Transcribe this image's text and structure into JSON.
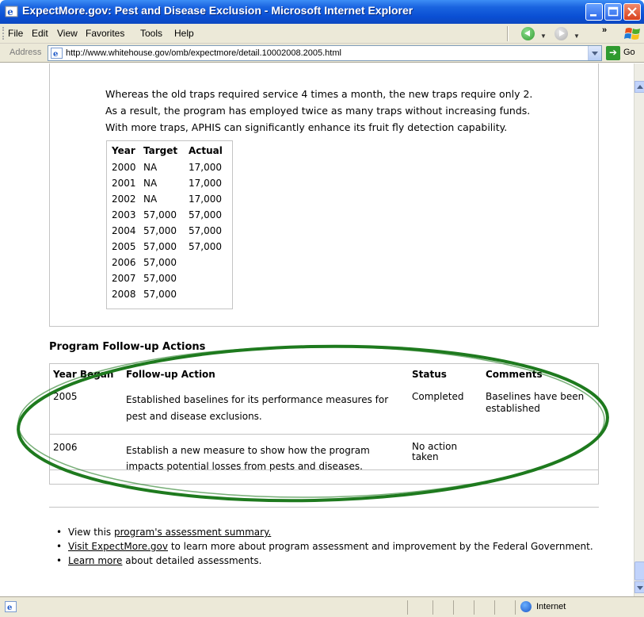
{
  "window": {
    "title": "ExpectMore.gov: Pest and Disease Exclusion - Microsoft Internet Explorer"
  },
  "menu": [
    "File",
    "Edit",
    "View",
    "Favorites",
    "Tools",
    "Help"
  ],
  "address": {
    "label": "Address",
    "url": "http://www.whitehouse.gov/omb/expectmore/detail.10002008.2005.html",
    "go_label": "Go"
  },
  "content": {
    "paragraph_lines": [
      "Whereas the old traps required service 4 times a month, the new traps require only 2.",
      "As a result, the program has employed twice as many traps without increasing funds.",
      "With more traps, APHIS can significantly enhance its fruit fly detection capability."
    ],
    "measure_table": {
      "headers": [
        "Year",
        "Target",
        "Actual"
      ],
      "rows": [
        [
          "2000",
          "NA",
          "17,000"
        ],
        [
          "2001",
          "NA",
          "17,000"
        ],
        [
          "2002",
          "NA",
          "17,000"
        ],
        [
          "2003",
          "57,000",
          "57,000"
        ],
        [
          "2004",
          "57,000",
          "57,000"
        ],
        [
          "2005",
          "57,000",
          "57,000"
        ],
        [
          "2006",
          "57,000",
          ""
        ],
        [
          "2007",
          "57,000",
          ""
        ],
        [
          "2008",
          "57,000",
          ""
        ]
      ]
    },
    "followup": {
      "title": "Program Follow-up Actions",
      "headers": [
        "Year Began",
        "Follow-up Action",
        "Status",
        "Comments"
      ],
      "rows": [
        {
          "year": "2005",
          "action": "Established baselines for its performance measures for pest and disease exclusions.",
          "status": "Completed",
          "comments": "Baselines have been established"
        },
        {
          "year": "2006",
          "action": "Establish a new measure to show how the program impacts potential losses from pests and diseases.",
          "status": "No action taken",
          "comments": ""
        }
      ]
    },
    "links": [
      {
        "before": "View this ",
        "link": "program's assessment summary.",
        "after": ""
      },
      {
        "before": "",
        "link": "Visit ExpectMore.gov",
        "after": " to learn more about program assessment and improvement by the Federal Government."
      },
      {
        "before": "",
        "link": "Learn more",
        "after": " about detailed assessments."
      }
    ]
  },
  "status": {
    "zone": "Internet"
  },
  "colors": {
    "titlebar": "#0a4fd4",
    "annotation_ellipse": "#1e7a1e"
  }
}
